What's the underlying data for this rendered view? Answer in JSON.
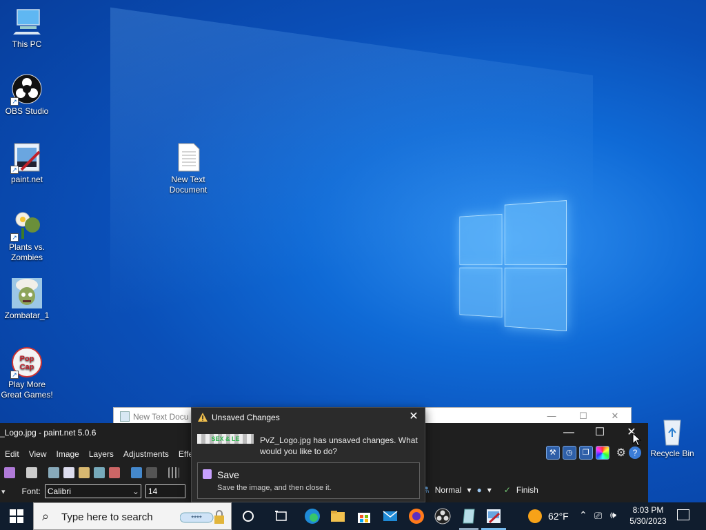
{
  "desktop": {
    "icons": [
      {
        "label": "This PC"
      },
      {
        "label": "OBS Studio"
      },
      {
        "label": "paint.net"
      },
      {
        "label": "Plants vs. Zombies"
      },
      {
        "label": "Zombatar_1"
      },
      {
        "label": "Play More Great Games!"
      },
      {
        "label": "New Text Document"
      },
      {
        "label": "Recycle Bin"
      }
    ]
  },
  "notepad_window": {
    "title": "New Text Docu"
  },
  "paintnet": {
    "title": "_Logo.jpg - paint.net 5.0.6",
    "menu": [
      "Edit",
      "View",
      "Image",
      "Layers",
      "Adjustments",
      "Effe"
    ],
    "font_label": "Font:",
    "font_value": "Calibri",
    "size_value": "14",
    "blend_mode": "Normal",
    "finish_label": "Finish"
  },
  "dialog": {
    "title": "Unsaved Changes",
    "thumb_text": "SEX & LE",
    "message": "PvZ_Logo.jpg has unsaved changes. What would you like to do?",
    "save_label": "Save",
    "save_desc": "Save the image, and then close it."
  },
  "taskbar": {
    "search_placeholder": "Type here to search",
    "weather": "62°F",
    "time": "8:03 PM",
    "date": "5/30/2023"
  },
  "colors": {
    "accent": "#0a4fb8",
    "dialog_bg": "#2b2b2b",
    "taskbar_bg": "#101d2e"
  }
}
